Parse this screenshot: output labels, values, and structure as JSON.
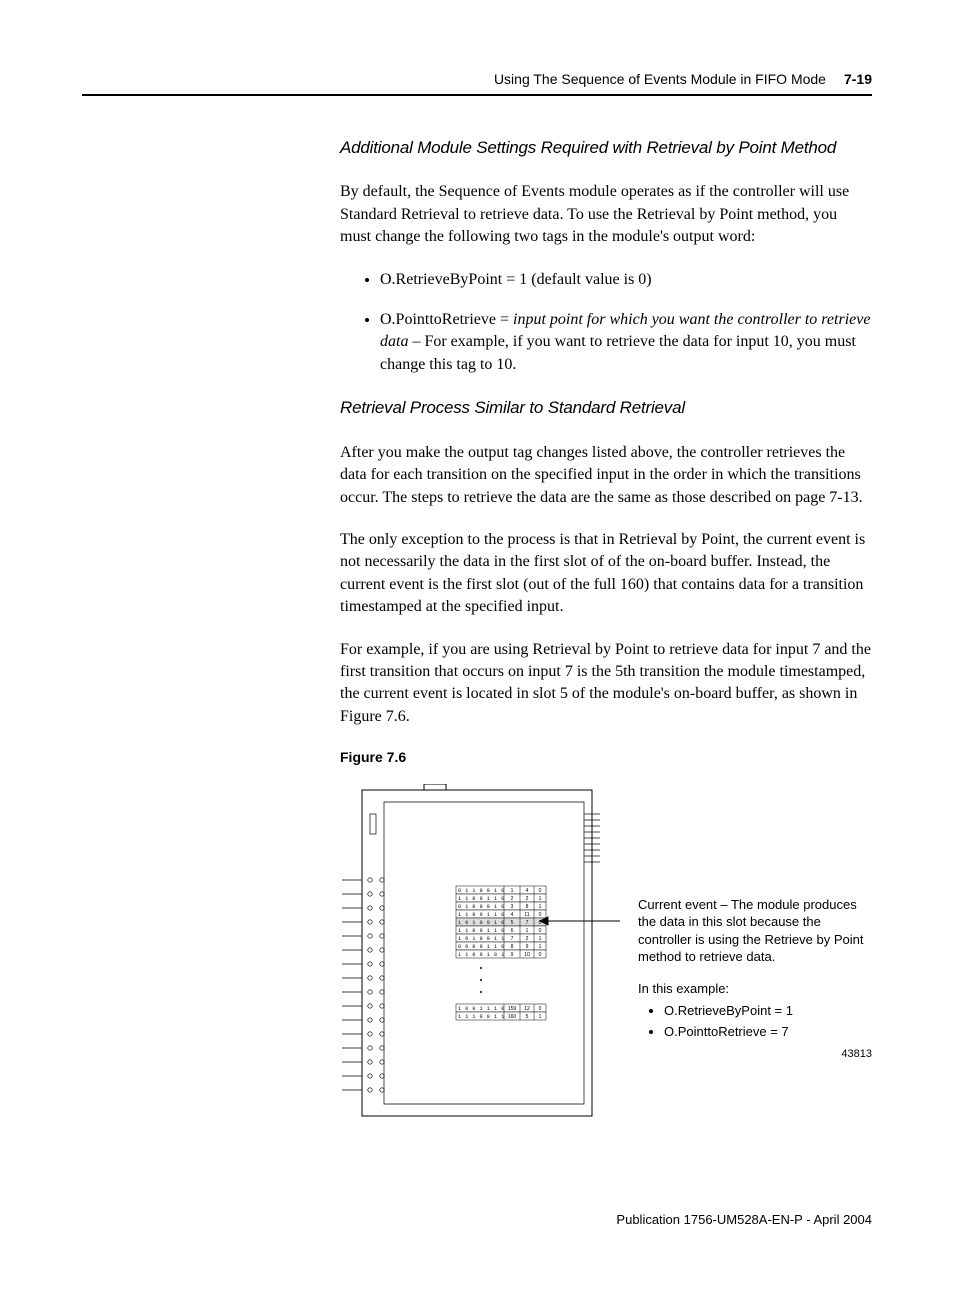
{
  "header": {
    "chapter_title": "Using The Sequence of Events Module in FIFO Mode",
    "page_number": "7-19"
  },
  "section1": {
    "heading": "Additional Module Settings Required with Retrieval by Point Method",
    "para": "By default, the Sequence of Events module operates as if the controller will use Standard Retrieval to retrieve data. To use the Retrieval by Point method, you must change the following two tags in the module's output word:",
    "bullet1": "O.RetrieveByPoint = 1 (default value is 0)",
    "bullet2_lead": "O.PointtoRetrieve = ",
    "bullet2_italic": "input point for which you want the controller to retrieve data",
    "bullet2_tail": " – For example, if you want to retrieve the data for input 10, you must change this tag to 10."
  },
  "section2": {
    "heading": "Retrieval Process Similar to Standard Retrieval",
    "para1": "After you make the output tag changes listed above, the controller retrieves the data for each transition on the specified input in the order in which the transitions occur. The steps to retrieve the data are the same as those described on page 7-13.",
    "para2": "The only exception to the process is that in Retrieval by Point, the current event is not necessarily the data in the first slot of of the on-board buffer. Instead, the current event is the first slot (out of the full 160) that contains data for a transition timestamped at the specified input.",
    "para3": "For example, if you are using Retrieval by Point to retrieve data for input 7 and the first transition that occurs on input 7 is the 5th transition the module timestamped, the current event is located in slot 5 of the module's on-board buffer, as shown in Figure 7.6."
  },
  "figure": {
    "label": "Figure 7.6",
    "callout1": "Current event – The module produces the data in this slot because the controller is using the Retrieve by Point method to retrieve data.",
    "callout2_title": "In this example:",
    "callout2_item1": "O.RetrieveByPoint = 1",
    "callout2_item2": "O.PointtoRetrieve = 7",
    "fig_id": "43813",
    "buffer_rows": [
      {
        "bits": "0 1 1 0 0 1 0",
        "slot": "1",
        "c2": "4",
        "c3": "0"
      },
      {
        "bits": "1 1 0 0 1 1 0",
        "slot": "2",
        "c2": "2",
        "c3": "1"
      },
      {
        "bits": "0 1 0 0 0 1 0",
        "slot": "3",
        "c2": "8",
        "c3": "1"
      },
      {
        "bits": "1 1 0 0 1 1 0",
        "slot": "4",
        "c2": "11",
        "c3": "0"
      },
      {
        "bits": "1 0 1 0 0 1 0",
        "slot": "5",
        "c2": "7",
        "c3": "0"
      },
      {
        "bits": "1 1 0 0 1 1 0",
        "slot": "6",
        "c2": "1",
        "c3": "0"
      },
      {
        "bits": "1 0 1 0 0 1 1",
        "slot": "7",
        "c2": "2",
        "c3": "1"
      },
      {
        "bits": "0 0 0 0 1 1 0",
        "slot": "8",
        "c2": "9",
        "c3": "1"
      },
      {
        "bits": "1 1 0 0 1 0 1",
        "slot": "9",
        "c2": "10",
        "c3": "0"
      }
    ],
    "buffer_tail": [
      {
        "bits": "1 0 0 1 1 1 0",
        "slot": "159",
        "c2": "12",
        "c3": "0"
      },
      {
        "bits": "1 1 1 0 0 1 1",
        "slot": "160",
        "c2": "5",
        "c3": "1"
      }
    ]
  },
  "footer": {
    "pub": "Publication 1756-UM528A-EN-P - April 2004"
  }
}
